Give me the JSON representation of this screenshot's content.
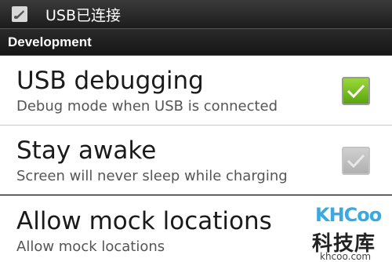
{
  "status_bar": {
    "notification_icon": "usb-debug-icon",
    "text": "USB已连接"
  },
  "section": {
    "title": "Development"
  },
  "preferences": [
    {
      "title": "USB debugging",
      "summary": "Debug mode when USB is connected",
      "checked": true,
      "enabled": true
    },
    {
      "title": "Stay awake",
      "summary": "Screen will never sleep while charging",
      "checked": true,
      "enabled": false
    },
    {
      "title": "Allow mock locations",
      "summary": "Allow mock locations"
    }
  ],
  "watermark": {
    "logo_text": "KHCoo",
    "name": "科技库",
    "domain": "khcoo.com"
  },
  "colors": {
    "checkbox_enabled": "#5aa40e",
    "checkbox_disabled": "#b0b0b0",
    "watermark_logo": "#3aa9e0"
  }
}
